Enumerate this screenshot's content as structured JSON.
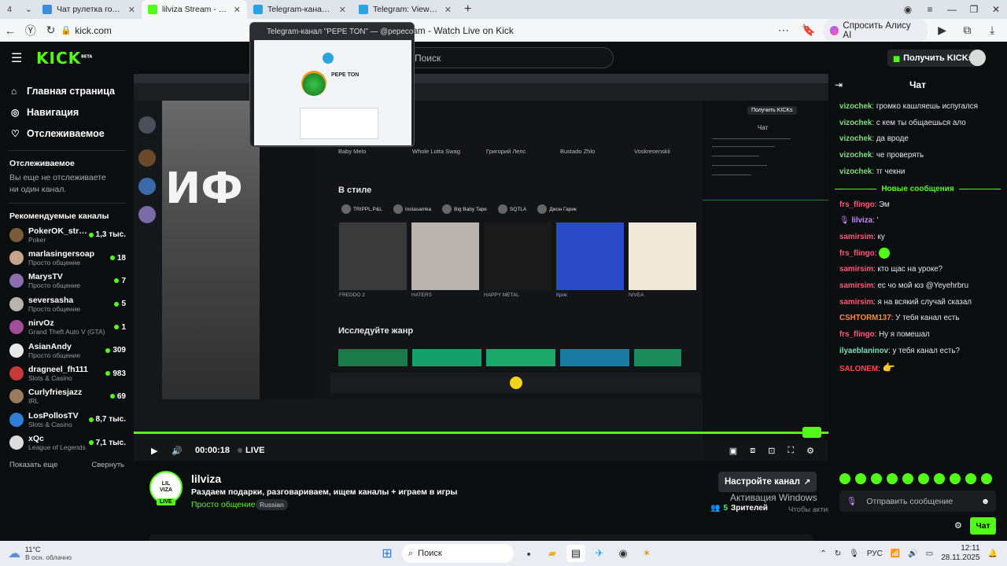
{
  "browser": {
    "tab_count": "4",
    "tabs": [
      {
        "label": "Чат рулетка голосовая —",
        "color": "#3a8fd8"
      },
      {
        "label": "lilviza Stream - Watch L",
        "color": "#53fc18"
      },
      {
        "label": "Telegram-канал \"PEPE",
        "color": "#2aa3e0"
      },
      {
        "label": "Telegram: View @pepeco",
        "color": "#2aa3e0"
      }
    ],
    "url": "kick.com",
    "page_title": "Stream - Watch Live on Kick",
    "alisa_label": "Спросить Алису AI",
    "preview_title": "Telegram-канал \"PEPE TON\" — @pepecoin_to...",
    "preview_channel": "PEPE TON"
  },
  "header": {
    "logo": "KICK",
    "logo_badge": "BETA",
    "search_placeholder": "Поиск",
    "get_kicks": "Получить KICKs"
  },
  "sidebar": {
    "nav": [
      {
        "label": "Главная страница",
        "icon": "home-icon"
      },
      {
        "label": "Навигация",
        "icon": "compass-icon"
      },
      {
        "label": "Отслеживаемое",
        "icon": "heart-icon"
      }
    ],
    "following_title": "Отслеживаемое",
    "following_empty": "Вы еще не отслеживаете ни один канал.",
    "recommended_title": "Рекомендуемые каналы",
    "channels": [
      {
        "name": "PokerOK_stre...",
        "category": "Poker",
        "viewers": "1,3 тыс.",
        "color": "#7a5c3a"
      },
      {
        "name": "marlasingersoap",
        "category": "Просто общение",
        "viewers": "18",
        "color": "#c9a38a"
      },
      {
        "name": "MarysTV",
        "category": "Просто общение",
        "viewers": "7",
        "color": "#8a6fb0"
      },
      {
        "name": "seversasha",
        "category": "Просто общение",
        "viewers": "5",
        "color": "#b9b3ad"
      },
      {
        "name": "nirvOz",
        "category": "Grand Theft Auto V (GTA)",
        "viewers": "1",
        "color": "#a24d9a"
      },
      {
        "name": "AsianAndy",
        "category": "Просто общение",
        "viewers": "309",
        "color": "#e8e8e8"
      },
      {
        "name": "dragneel_fh111",
        "category": "Slots & Casino",
        "viewers": "983",
        "color": "#c23a3a"
      },
      {
        "name": "Curlyfriesjazz",
        "category": "IRL",
        "viewers": "69",
        "color": "#9a7b60"
      },
      {
        "name": "LosPollosTV",
        "category": "Slots & Casino",
        "viewers": "8,7 тыс.",
        "color": "#2e7fd6"
      },
      {
        "name": "xQc",
        "category": "League of Legends",
        "viewers": "7,1 тыс.",
        "color": "#dcdcdc"
      }
    ],
    "show_more": "Показать еще",
    "collapse": "Свернуть"
  },
  "player": {
    "time": "00:00:18",
    "live": "LIVE",
    "progress": 0.98
  },
  "video_content": {
    "in_style": "В стиле",
    "explore_genre": "Исследуйте жанр",
    "albums": [
      "Baby Melo",
      "Whole Lotta Swag",
      "Григорий Лепс",
      "Bustado Zhlo",
      "Voskresenskii"
    ],
    "artists": [
      "TRIPPL.P&L",
      "Instasamka",
      "Big Baby Tape",
      "SQTLA",
      "Джон Гарик"
    ],
    "cards": [
      "FREDDO 2",
      "HATERS",
      "HAPPY METAL",
      "Крик",
      "NIVEA"
    ],
    "get_kicks": "Получить KICKs",
    "chat_label": "Чат"
  },
  "stream": {
    "avatar_text": "LIL VIZA",
    "live_badge": "LIVE",
    "username": "lilviza",
    "title": "Раздаем подарки, разговариваем, ищем каналы + играем в игры",
    "category": "Просто общение",
    "language": "Russian",
    "setup_channel": "Настройте канал",
    "viewers": "5",
    "viewers_label": "Зрителей",
    "activation_title": "Активация Windows",
    "activation_text": "Чтобы активировать Windows, перейдите в раздел \"Параметры\"."
  },
  "chat": {
    "title": "Чат",
    "new_messages": "Новые сообщения",
    "messages_old": [
      {
        "user": "vizochek",
        "text": "громко кашляешь испугался",
        "color": "#7fe07f"
      },
      {
        "user": "vizochek",
        "text": "с кем ты общаешься ало",
        "color": "#7fe07f"
      },
      {
        "user": "vizochek",
        "text": "да вроде",
        "color": "#7fe07f"
      },
      {
        "user": "vizochek",
        "text": "че проверять",
        "color": "#7fe07f"
      },
      {
        "user": "vizochek",
        "text": "тг чекни",
        "color": "#7fe07f"
      }
    ],
    "messages_new": [
      {
        "user": "frs_flingo",
        "text": "Эм",
        "color": "#ff5a7a"
      },
      {
        "user": "lilviza",
        "text": "'",
        "color": "#c58aff"
      },
      {
        "user": "samirsim",
        "text": "ку",
        "color": "#ff5a7a"
      },
      {
        "user": "frs_flingo",
        "text": "",
        "color": "#ff5a7a"
      },
      {
        "user": "samirsim",
        "text": "кто щас на уроке?",
        "color": "#ff5a7a"
      },
      {
        "user": "samirsim",
        "text": "ес чо мой юз @Yeyehrbru",
        "color": "#ff5a7a"
      },
      {
        "user": "samirsim",
        "text": "я на всякий случай сказал",
        "color": "#ff5a7a"
      },
      {
        "user": "CSHTORM137",
        "text": "У тебя канал есть",
        "color": "#ff8a3a"
      },
      {
        "user": "frs_flingo",
        "text": "Ну я помешал",
        "color": "#ff5a7a"
      },
      {
        "user": "ilyaeblaninov",
        "text": "у тебя канал есть?",
        "color": "#7fe0c0"
      },
      {
        "user": "SALONEM",
        "text": "",
        "color": "#ff4a4a"
      }
    ],
    "input_placeholder": "Отправить сообщение",
    "send_label": "Чат"
  },
  "taskbar": {
    "weather_temp": "11°C",
    "weather_desc": "В осн. облачно",
    "search_label": "Поиск",
    "lang": "РУС",
    "time": "12:11",
    "date": "28.11.2025"
  },
  "colors": {
    "accent": "#53fc18",
    "background": "#0b0e0f"
  }
}
